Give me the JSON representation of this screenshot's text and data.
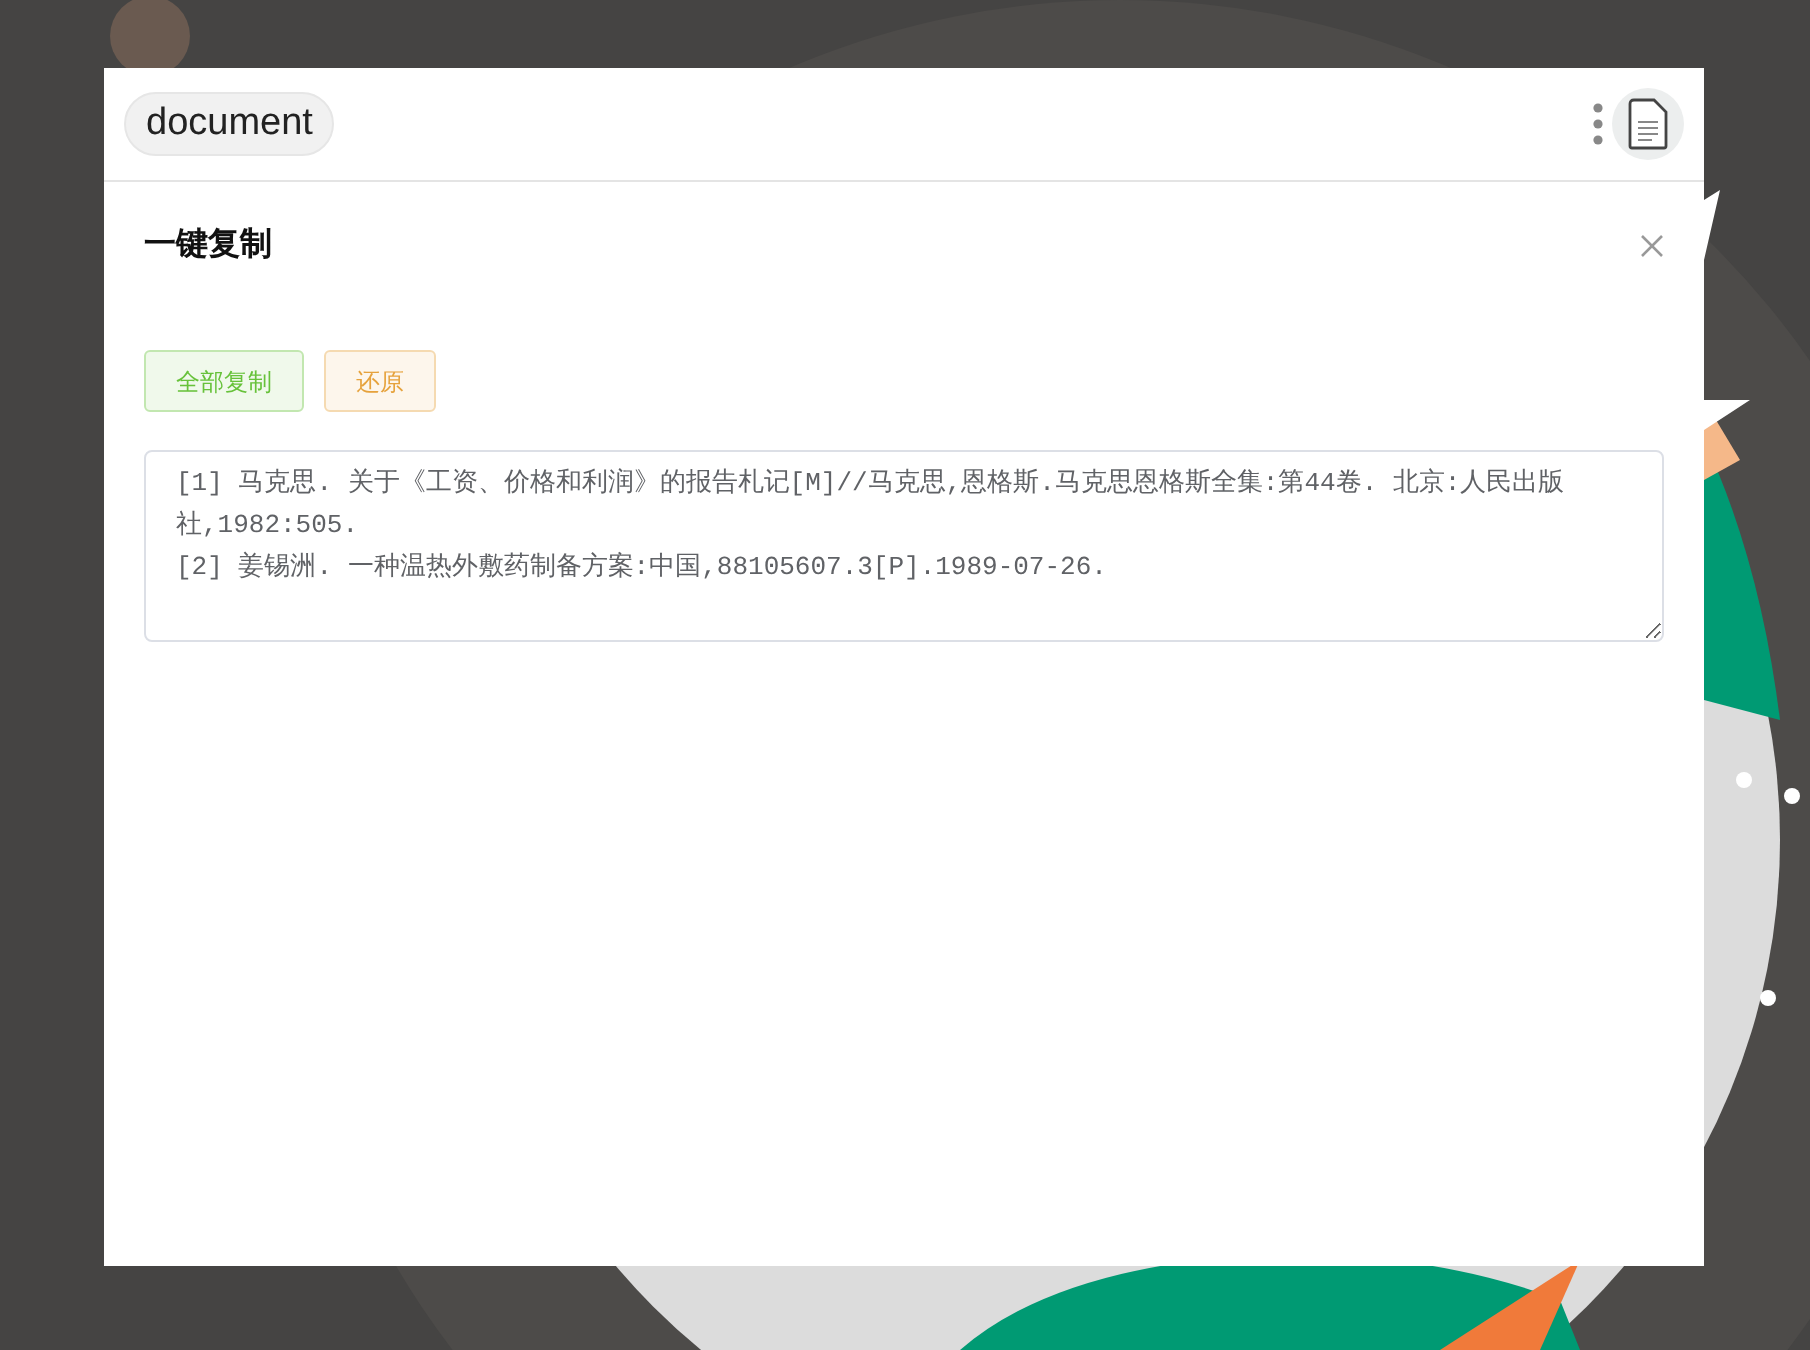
{
  "header": {
    "tag": "document"
  },
  "dialog": {
    "title": "一键复制",
    "buttons": [
      {
        "label": "全部复制",
        "kind": "success"
      },
      {
        "label": "还原",
        "kind": "warning"
      }
    ],
    "text": {
      "value": "[1] 马克思. 关于《工资、价格和利润》的报告札记[M]//马克思,恩格斯.马克思恩格斯全集:第44卷. 北京:人民出版社,1982:505.\n[2] 姜锡洲. 一种温热外敷药制备方案:中国,88105607.3[P].1989-07-26."
    }
  }
}
